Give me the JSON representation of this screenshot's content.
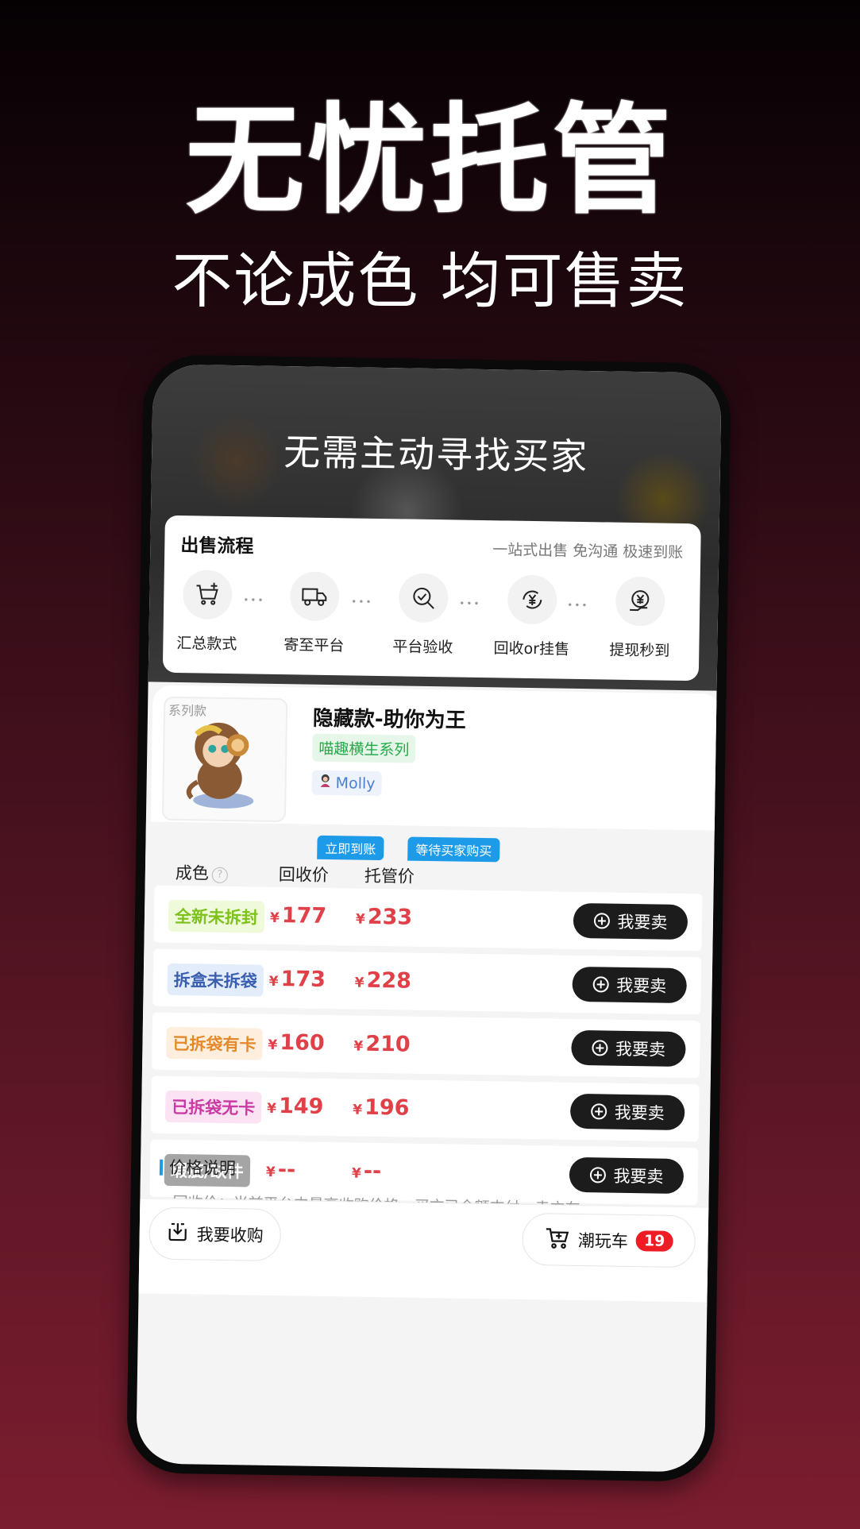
{
  "hero": {
    "title": "无忧托管",
    "subtitle": "不论成色 均可售卖"
  },
  "screen": {
    "heading": "无需主动寻找买家"
  },
  "flow": {
    "title": "出售流程",
    "tagline": "一站式出售 免沟通 极速到账",
    "steps": [
      {
        "label": "汇总款式",
        "icon": "cart-add-icon"
      },
      {
        "label": "寄至平台",
        "icon": "delivery-truck-icon"
      },
      {
        "label": "平台验收",
        "icon": "inspect-check-icon"
      },
      {
        "label": "回收or挂售",
        "icon": "yuan-cycle-icon"
      },
      {
        "label": "提现秒到",
        "icon": "withdraw-yuan-icon"
      }
    ]
  },
  "product": {
    "thumb_tag": "系列款",
    "name": "隐藏款-助你为王",
    "series": "喵趣横生系列",
    "ip": "Molly"
  },
  "prices": {
    "condition_header": "成色",
    "help_symbol": "?",
    "recycle_header": "回收价",
    "recycle_badge": "立即到账",
    "custody_header": "托管价",
    "custody_badge": "等待买家购买",
    "currency": "¥",
    "sell_label": "我要卖",
    "rows": [
      {
        "condition": "全新未拆封",
        "recycle": "177",
        "custody": "233",
        "tag_bg": "#eefad9",
        "tag_color": "#7cc21a"
      },
      {
        "condition": "拆盒未拆袋",
        "recycle": "173",
        "custody": "228",
        "tag_bg": "#e3ecfb",
        "tag_color": "#3b5fb0"
      },
      {
        "condition": "已拆袋有卡",
        "recycle": "160",
        "custody": "210",
        "tag_bg": "#fdeedd",
        "tag_color": "#e58a2b"
      },
      {
        "condition": "已拆袋无卡",
        "recycle": "149",
        "custody": "196",
        "tag_bg": "#fbe3f4",
        "tag_color": "#c93aa2"
      },
      {
        "condition": "瑕疵/缺件",
        "recycle": "--",
        "custody": "--",
        "tag_bg": "#a5a5a5",
        "tag_color": "#ffffff"
      }
    ],
    "explain_title": "价格说明",
    "explain_text": "• 回收价：当前平台内最高收购价格，买方已全额支付，卖方在"
  },
  "bottom": {
    "buy_label": "我要收购",
    "cart_label": "潮玩车",
    "cart_count": "19"
  }
}
